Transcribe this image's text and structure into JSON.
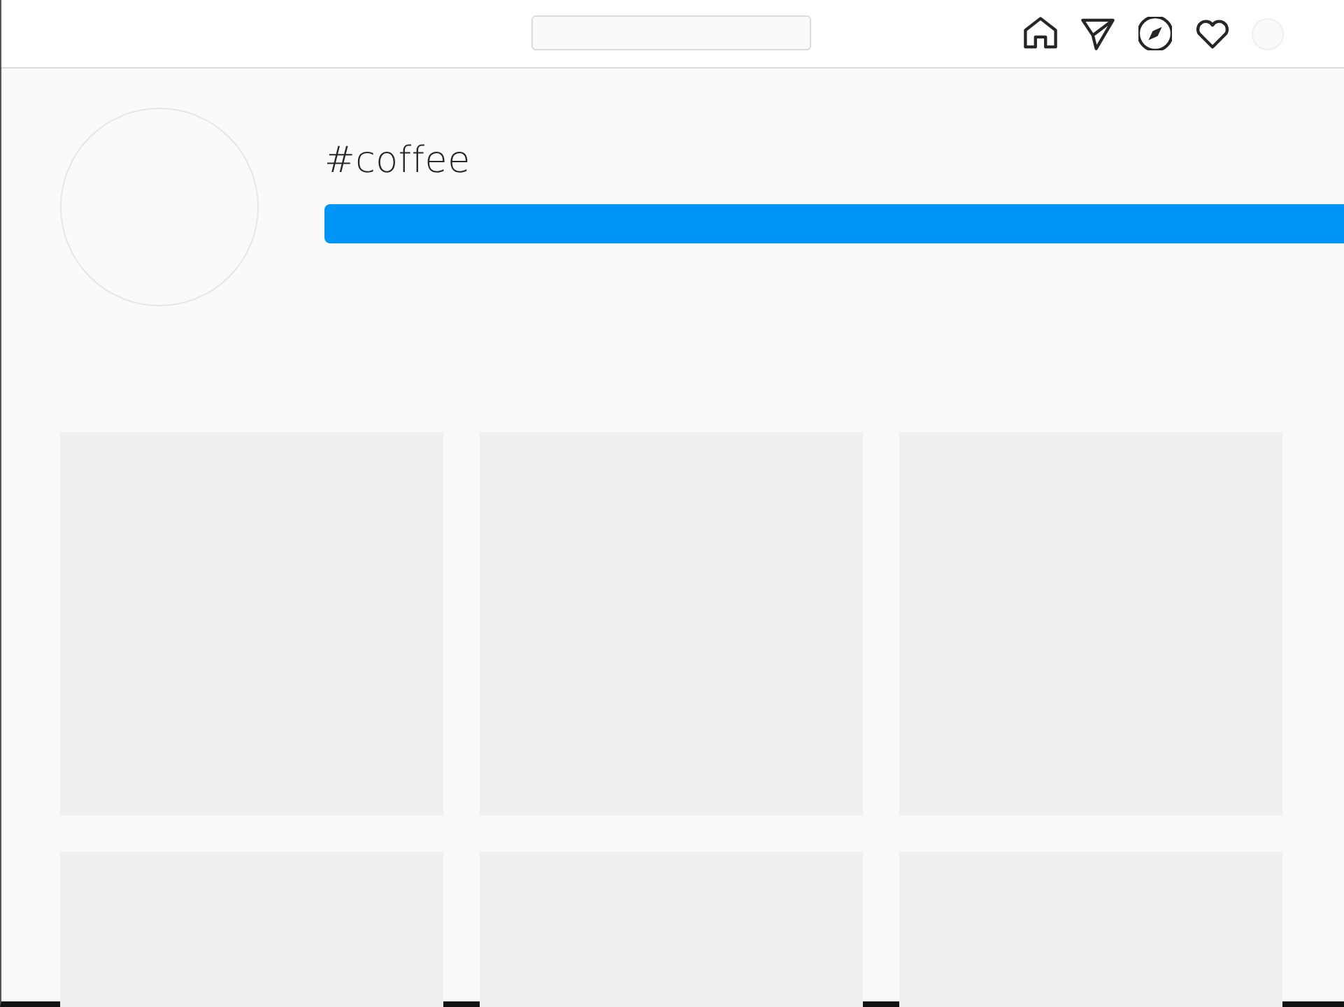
{
  "header": {
    "nav": [
      {
        "kind": "home"
      },
      {
        "kind": "direct"
      },
      {
        "kind": "explore"
      },
      {
        "kind": "activity"
      },
      {
        "kind": "avatar"
      }
    ]
  },
  "hashtag": {
    "title": "#coffee"
  },
  "posts": [
    {
      "kind": "placeholder"
    },
    {
      "kind": "placeholder"
    },
    {
      "kind": "placeholder"
    },
    {
      "kind": "placeholder"
    },
    {
      "kind": "placeholder"
    },
    {
      "kind": "placeholder"
    }
  ]
}
